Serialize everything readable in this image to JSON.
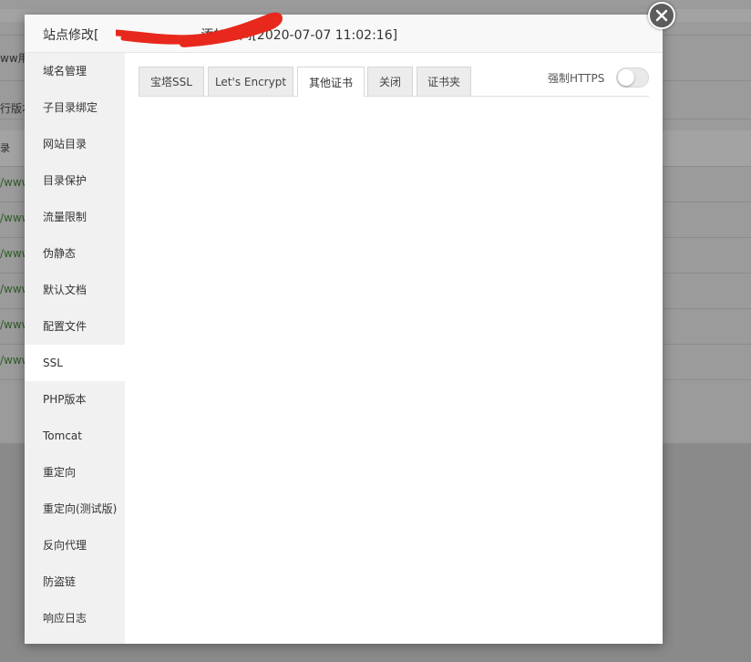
{
  "background": {
    "row_texts": [
      "ww用",
      "行版本",
      "录"
    ],
    "link_texts": [
      "/www",
      "/www",
      "/www",
      "/www",
      "/www",
      "/www"
    ]
  },
  "modal": {
    "title": "站点修改[",
    "title_suffix": "添加时间[2020-07-07 11:02:16]",
    "close_icon": "close-icon"
  },
  "sidebar": {
    "items": [
      {
        "label": "域名管理"
      },
      {
        "label": "子目录绑定"
      },
      {
        "label": "网站目录"
      },
      {
        "label": "目录保护"
      },
      {
        "label": "流量限制"
      },
      {
        "label": "伪静态"
      },
      {
        "label": "默认文档"
      },
      {
        "label": "配置文件"
      },
      {
        "label": "SSL",
        "active": true
      },
      {
        "label": "PHP版本"
      },
      {
        "label": "Tomcat"
      },
      {
        "label": "重定向"
      },
      {
        "label": "重定向(测试版)"
      },
      {
        "label": "反向代理"
      },
      {
        "label": "防盗链"
      },
      {
        "label": "响应日志"
      }
    ]
  },
  "ssl": {
    "tabs": [
      {
        "label": "宝塔SSL"
      },
      {
        "label": "Let's Encrypt"
      },
      {
        "label": "其他证书",
        "active": true
      },
      {
        "label": "关闭"
      },
      {
        "label": "证书夹"
      }
    ],
    "force_https_label": "强制HTTPS",
    "force_https_enabled": false
  },
  "colors": {
    "overlay": "#9b9b9b",
    "scribble": "#e8281c",
    "sidebar_bg": "#f1f1f1",
    "link_green": "#2e5d26"
  }
}
